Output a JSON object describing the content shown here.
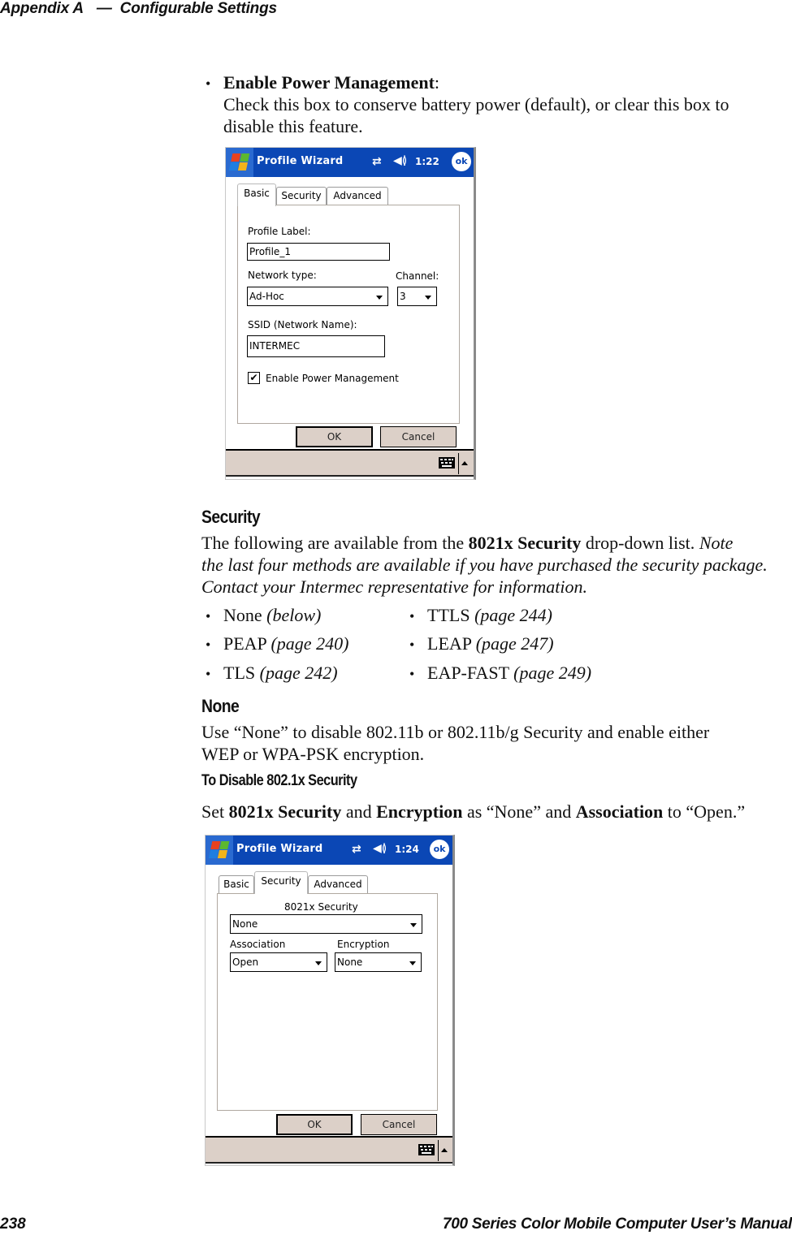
{
  "header": {
    "appendix": "Appendix A",
    "dash": "—",
    "section": "Configurable Settings"
  },
  "footer": {
    "page_number": "238",
    "manual_title": "700 Series Color Mobile Computer User’s Manual"
  },
  "power_mgmt": {
    "bullet": "•",
    "term": "Enable Power Management",
    "colon": ":",
    "desc_line1": "Check this box to conserve battery power (default), or clear this box to",
    "desc_line2": "disable this feature."
  },
  "screen1": {
    "title": "Profile Wizard",
    "clock": "1:22",
    "ok_label": "ok",
    "tabs": [
      {
        "label": "Basic",
        "active": true
      },
      {
        "label": "Security",
        "active": false
      },
      {
        "label": "Advanced",
        "active": false
      }
    ],
    "profile_label_caption": "Profile Label:",
    "profile_label_value": "Profile_1",
    "network_type_caption": "Network type:",
    "network_type_value": "Ad-Hoc",
    "channel_caption": "Channel:",
    "channel_value": "3",
    "ssid_caption": "SSID (Network Name):",
    "ssid_value": "INTERMEC",
    "power_mgmt_label": "Enable Power Management",
    "power_mgmt_checked": true,
    "check_glyph": "✔",
    "ok_button": "OK",
    "cancel_button": "Cancel"
  },
  "security": {
    "heading": "Security",
    "intro_prefix": "The following are available from the ",
    "intro_bold": "8021x Security",
    "intro_suffix": " drop-down list. ",
    "note_line1": "Note",
    "note_line2": "the last four methods are available if you have purchased the security package.",
    "note_line3": "Contact your Intermec representative for information.",
    "methods": [
      {
        "name": "None",
        "ref": "(below)"
      },
      {
        "name": "PEAP",
        "ref": "(page 240)"
      },
      {
        "name": "TLS",
        "ref": "(page 242)"
      },
      {
        "name": "TTLS",
        "ref": "(page 244)"
      },
      {
        "name": "LEAP",
        "ref": "(page 247)"
      },
      {
        "name": "EAP-FAST",
        "ref": "(page 249)"
      }
    ]
  },
  "none_section": {
    "heading": "None",
    "line1": "Use “None” to disable 802.11b or 802.11b/g Security and enable either",
    "line2": "WEP or WPA-PSK encryption.",
    "subheading": "To Disable 802.1x Security",
    "instr_set": "Set ",
    "instr_b1": "8021x Security",
    "instr_and": " and ",
    "instr_b2": "Encryption",
    "instr_as": " as “None” and ",
    "instr_b3": "Association",
    "instr_to": " to “Open.”"
  },
  "screen2": {
    "title": "Profile Wizard",
    "clock": "1:24",
    "ok_label": "ok",
    "tabs": [
      {
        "label": "Basic",
        "active": false
      },
      {
        "label": "Security",
        "active": true
      },
      {
        "label": "Advanced",
        "active": false
      }
    ],
    "security_caption": "8021x Security",
    "security_value": "None",
    "association_caption": "Association",
    "association_value": "Open",
    "encryption_caption": "Encryption",
    "encryption_value": "None",
    "ok_button": "OK",
    "cancel_button": "Cancel"
  }
}
